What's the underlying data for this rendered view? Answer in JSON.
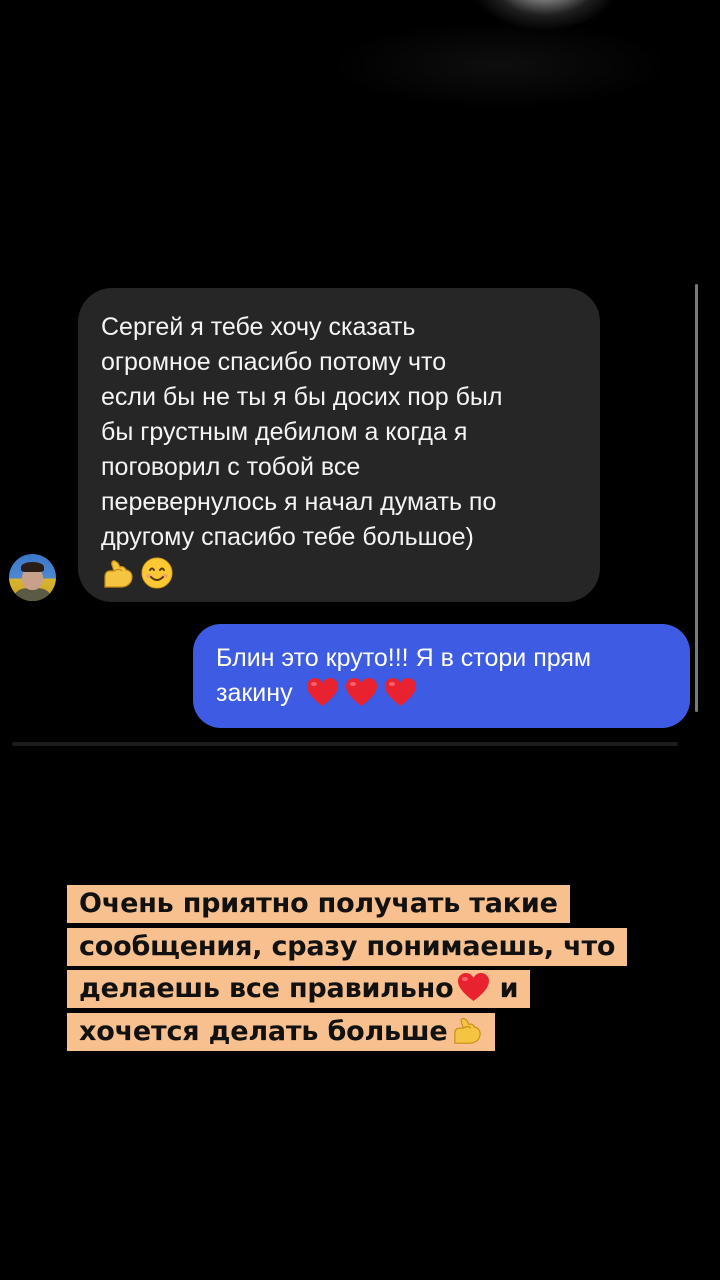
{
  "chat": {
    "incoming": {
      "lines": [
        "Сергей я тебе хочу сказать",
        "огромное спасибо потому что",
        "если бы не ты я бы досих пор был",
        "бы грустным дебилом а когда я",
        "поговорил с тобой все",
        "перевернулось я начал думать по",
        "другому спасибо тебе большое)"
      ],
      "emojis": [
        "flexed-biceps-icon",
        "smiling-face-icon"
      ]
    },
    "outgoing": {
      "line1": "Блин это круто!!! Я в стори прям",
      "line2": "закину",
      "emojis": [
        "red-heart-icon",
        "red-heart-icon",
        "red-heart-icon"
      ]
    }
  },
  "caption": {
    "line1": "Очень приятно получать такие",
    "line2": "сообщения, сразу понимаешь, что",
    "line3": "делаешь все правильно",
    "line3_end": "и",
    "line4": "хочется делать больше",
    "highlight_color": "#f7c08e",
    "emojis": [
      "red-heart-icon",
      "flexed-biceps-icon"
    ]
  },
  "colors": {
    "background": "#000000",
    "incoming_bubble": "#262626",
    "outgoing_bubble": "#3d5be3"
  }
}
